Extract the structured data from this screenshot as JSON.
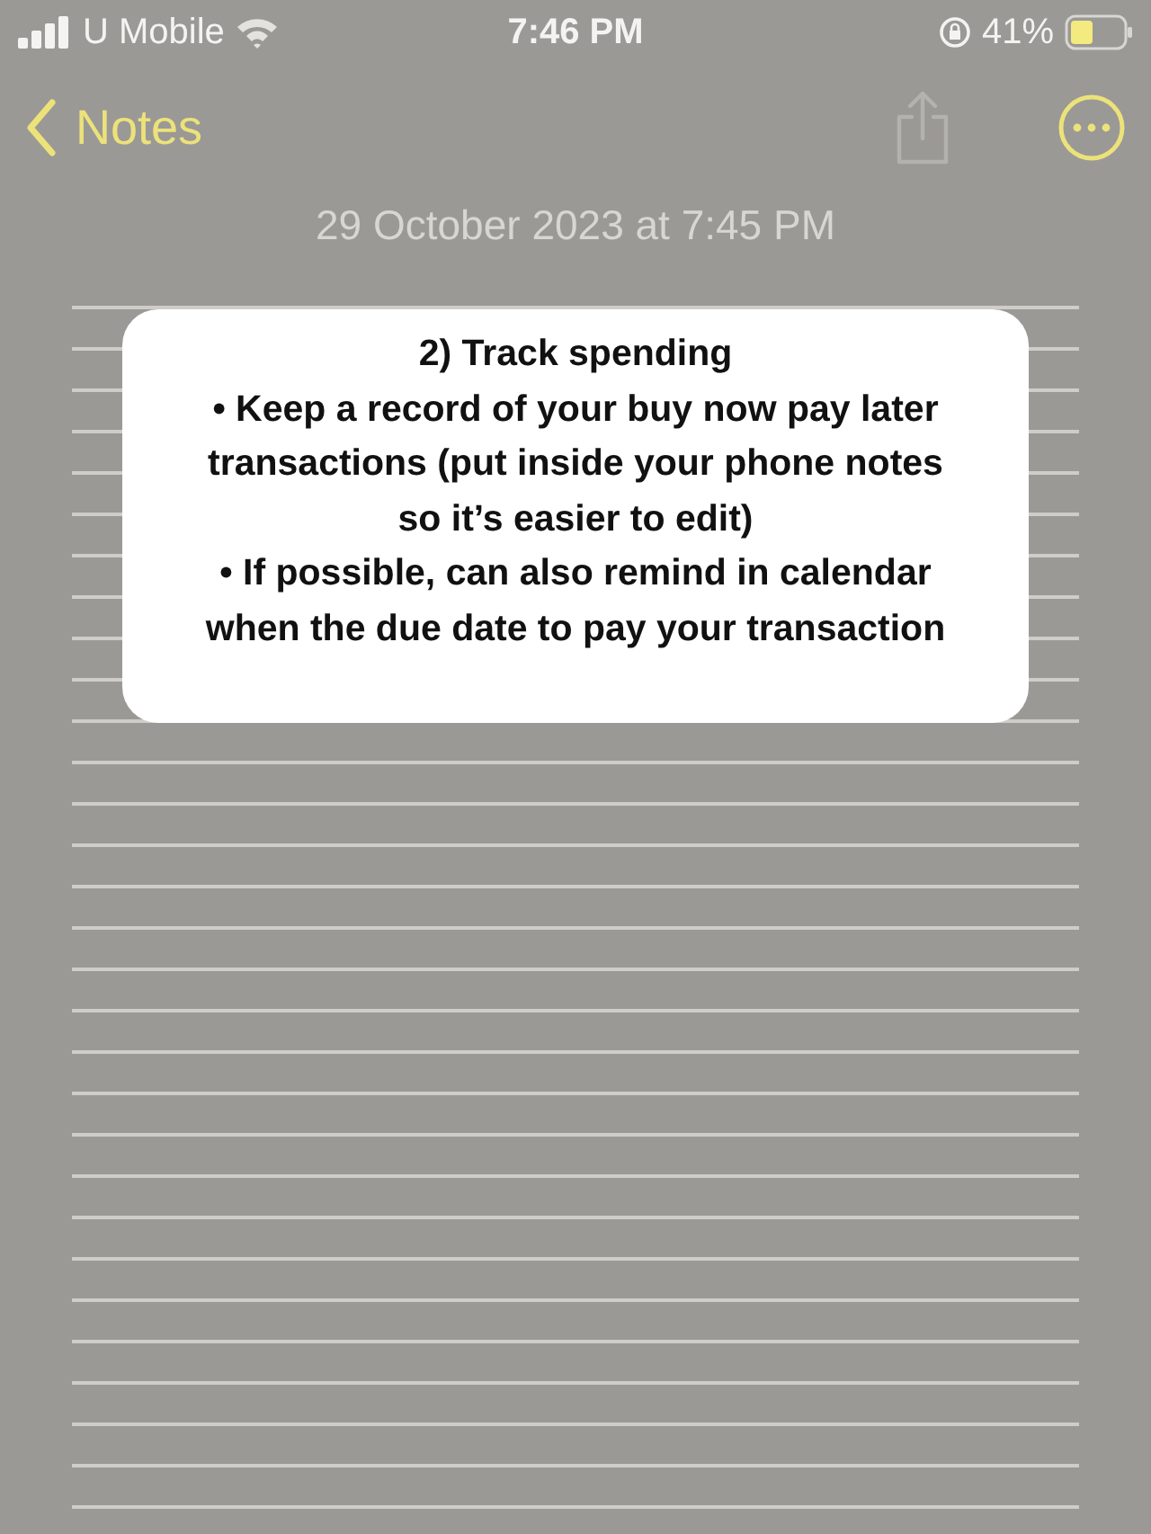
{
  "status_bar": {
    "carrier": "U Mobile",
    "time": "7:46 PM",
    "battery": "41%"
  },
  "nav": {
    "back_label": "Notes"
  },
  "note": {
    "date": "29 October 2023 at 7:45 PM"
  },
  "card": {
    "lines": [
      "2) Track spending",
      "• Keep a record of your buy now pay later",
      "transactions (put inside your phone notes",
      "so it’s easier to edit)",
      "• If possible, can also remind in calendar",
      "when the due date to pay your transaction"
    ]
  }
}
